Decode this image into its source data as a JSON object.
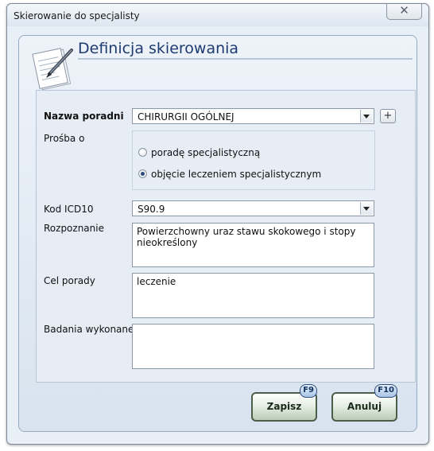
{
  "window": {
    "title": "Skierowanie do specjalisty"
  },
  "header": {
    "title": "Definicja skierowania"
  },
  "form": {
    "nazwa_poradni": {
      "label": "Nazwa poradni",
      "value": "CHIRURGII OGÓLNEJ",
      "add_label": "+"
    },
    "prosba": {
      "label": "Prośba o",
      "options": [
        {
          "label": "poradę specjalistyczną",
          "selected": false
        },
        {
          "label": "objęcie leczeniem specjalistycznym",
          "selected": true
        }
      ]
    },
    "kod_icd10": {
      "label": "Kod ICD10",
      "value": "S90.9"
    },
    "rozpoznanie": {
      "label": "Rozpoznanie",
      "value": "Powierzchowny uraz stawu skokowego i stopy nieokreślony"
    },
    "cel_porady": {
      "label": "Cel porady",
      "value": "leczenie"
    },
    "badania": {
      "label": "Badania wykonane",
      "value": ""
    }
  },
  "buttons": {
    "save": {
      "label": "Zapisz",
      "shortcut": "F9"
    },
    "cancel": {
      "label": "Anuluj",
      "shortcut": "F10"
    }
  },
  "icons": {
    "header": "document-pen-icon",
    "close": "close-icon",
    "dropdown": "chevron-down-icon"
  }
}
